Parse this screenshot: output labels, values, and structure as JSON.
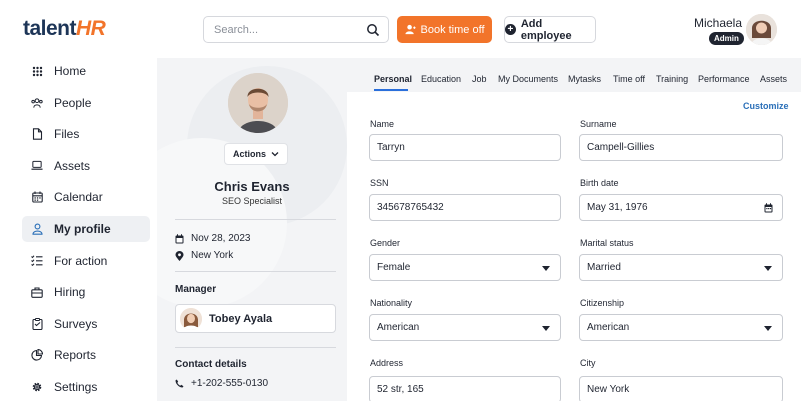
{
  "brand": {
    "part1": "talent",
    "part2": "HR"
  },
  "header": {
    "search_placeholder": "Search...",
    "book_label": "Book time off",
    "add_label": "Add employee",
    "user_name": "Michaela",
    "user_role": "Admin"
  },
  "sidebar": {
    "items": [
      {
        "label": "Home",
        "icon": "grid-icon"
      },
      {
        "label": "People",
        "icon": "people-icon"
      },
      {
        "label": "Files",
        "icon": "file-icon"
      },
      {
        "label": "Assets",
        "icon": "laptop-icon"
      },
      {
        "label": "Calendar",
        "icon": "calendar-icon"
      },
      {
        "label": "My profile",
        "icon": "user-icon",
        "active": true
      },
      {
        "label": "For action",
        "icon": "checklist-icon"
      },
      {
        "label": "Hiring",
        "icon": "briefcase-icon"
      },
      {
        "label": "Surveys",
        "icon": "clipboard-icon"
      },
      {
        "label": "Reports",
        "icon": "pie-chart-icon"
      },
      {
        "label": "Settings",
        "icon": "gear-icon"
      }
    ]
  },
  "profile": {
    "actions_label": "Actions",
    "name": "Chris Evans",
    "title": "SEO Specialist",
    "date": "Nov 28, 2023",
    "location": "New York",
    "manager_heading": "Manager",
    "manager_name": "Tobey Ayala",
    "contact_heading": "Contact details",
    "phone": "+1-202-555-0130"
  },
  "tabs": [
    "Personal",
    "Education",
    "Job",
    "My Documents",
    "Mytasks",
    "Time off",
    "Training",
    "Performance",
    "Assets"
  ],
  "active_tab": "Personal",
  "customize_label": "Customize",
  "form": {
    "name_label": "Name",
    "name_value": "Tarryn",
    "surname_label": "Surname",
    "surname_value": "Campell-Gillies",
    "ssn_label": "SSN",
    "ssn_value": "345678765432",
    "birth_label": "Birth date",
    "birth_value": "May 31, 1976",
    "gender_label": "Gender",
    "gender_value": "Female",
    "marital_label": "Marital status",
    "marital_value": "Married",
    "nationality_label": "Nationality",
    "nationality_value": "American",
    "citizenship_label": "Citizenship",
    "citizenship_value": "American",
    "address_label": "Address",
    "address_value": "52 str, 165",
    "city_label": "City",
    "city_value": "New York"
  },
  "colors": {
    "accent": "#f2742a",
    "brand_dark": "#1d3557",
    "link": "#2a6fb8",
    "panel": "#f3f4f6"
  }
}
